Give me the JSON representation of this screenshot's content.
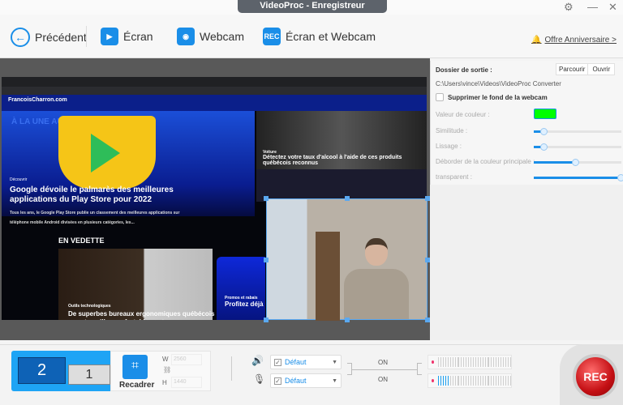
{
  "window": {
    "title": "VideoProc - Enregistreur"
  },
  "toolbar": {
    "back": "Précédent",
    "screen": "Écran",
    "webcam": "Webcam",
    "screen_webcam": "Écran et Webcam",
    "rec_icon": "REC",
    "offer": "Offre Anniversaire >"
  },
  "preview": {
    "site_logo": "FrancoisCharron.com",
    "hero_overlay": "À LA UNE AUJOURD'HUI",
    "hero_category": "Découvrir",
    "hero_title": "Google dévoile le palmarès des meilleures applications du Play Store pour 2022",
    "hero_summary": "Tous les ans, le Google Play Store publie un classement des meilleures applications sur téléphone mobile Android divisées en plusieurs catégories, les...",
    "side_category": "Voiture",
    "side_title": "Détectez votre taux d'alcool à l'aide de ces produits québécois reconnus",
    "section": "EN VEDETTE",
    "desk_category": "Outils technologiques",
    "desk_title": "De superbes bureaux ergonomiques québécois pour travailler confortablement",
    "card_category": "Promos et rabais",
    "card_title": "Profitez déjà"
  },
  "panel": {
    "output_label": "Dossier de sortie :",
    "browse": "Parcourir",
    "open": "Ouvrir",
    "path": "C:\\Users\\vince\\Videos\\VideoProc Converter",
    "remove_bg": "Supprimer le fond de la webcam",
    "color_label": "Valeur de couleur :",
    "color": "#00ff00",
    "sliders": [
      {
        "label": "Similitude :",
        "value": 0.12
      },
      {
        "label": "Lissage :",
        "value": 0.12
      },
      {
        "label": "Déborder de la couleur principale :",
        "value": 0.48
      },
      {
        "label": "transparent :",
        "value": 1.0
      }
    ]
  },
  "bottom": {
    "monitor_primary": "2",
    "monitor_secondary": "1",
    "crop": "Recadrer",
    "w_label": "W",
    "h_label": "H",
    "width": "2560",
    "height": "1440",
    "speaker": "Défaut",
    "mic": "Défaut",
    "speaker_state": "ON",
    "mic_state": "ON",
    "speaker_level": 0,
    "mic_level": 0.15,
    "rec": "REC"
  }
}
